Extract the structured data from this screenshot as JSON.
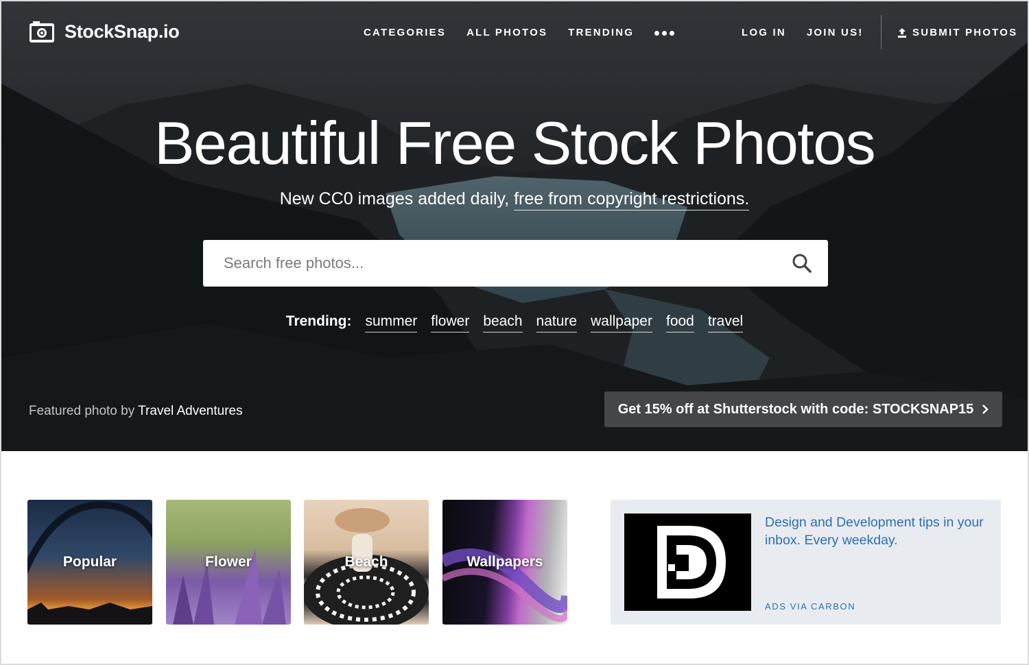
{
  "brand": {
    "name": "StockSnap.io",
    "icon": "camera-icon"
  },
  "nav": {
    "items": [
      "CATEGORIES",
      "ALL PHOTOS",
      "TRENDING"
    ],
    "more_icon": "more-dots-icon"
  },
  "account": {
    "login": "LOG IN",
    "join": "JOIN US!"
  },
  "submit": {
    "label": "SUBMIT PHOTOS",
    "icon": "upload-icon"
  },
  "hero": {
    "title": "Beautiful Free Stock Photos",
    "subtitle_prefix": "New CC0 images added daily,",
    "subtitle_link": "free from copyright restrictions."
  },
  "search": {
    "placeholder": "Search free photos...",
    "value": "",
    "icon": "search-icon"
  },
  "trending": {
    "label": "Trending:",
    "tags": [
      "summer",
      "flower",
      "beach",
      "nature",
      "wallpaper",
      "food",
      "travel"
    ]
  },
  "featured": {
    "prefix": "Featured photo by",
    "author": "Travel Adventures"
  },
  "promo": {
    "text": "Get 15% off at Shutterstock with code: STOCKSNAP15",
    "icon": "chevron-right-icon"
  },
  "categories": [
    "Popular",
    "Flower",
    "Beach",
    "Wallpapers"
  ],
  "ad": {
    "text": "Design and Development tips in your inbox. Every weekday.",
    "via": "ADS VIA CARBON",
    "logo": "dd-logo-icon"
  },
  "colors": {
    "ad_text": "#2d6eb5",
    "ad_bg": "#e8ecf1"
  }
}
